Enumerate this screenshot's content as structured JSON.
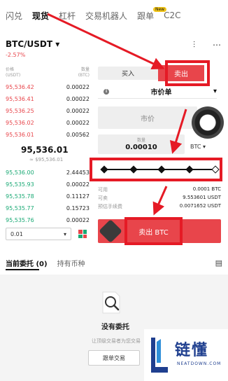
{
  "tabs": [
    {
      "label": "闪兑",
      "active": false
    },
    {
      "label": "现货",
      "active": true
    },
    {
      "label": "杠杆",
      "active": false
    },
    {
      "label": "交易机器人",
      "active": false
    },
    {
      "label": "跟单",
      "active": false,
      "badge": "New"
    },
    {
      "label": "C2C",
      "active": false
    }
  ],
  "pair": {
    "symbol": "BTC/USDT",
    "change": "-2.57%"
  },
  "orderbook": {
    "price_header": "价格\n(USDT)",
    "qty_header": "数量\n(BTC)",
    "asks": [
      {
        "price": "95,536.42",
        "qty": "0.00022"
      },
      {
        "price": "95,536.41",
        "qty": "0.00022"
      },
      {
        "price": "95,536.25",
        "qty": "0.00022"
      },
      {
        "price": "95,536.02",
        "qty": "0.00022"
      },
      {
        "price": "95,536.01",
        "qty": "0.00562"
      }
    ],
    "mid_price": "95,536.01",
    "mid_sub": "≈ $95,536.01",
    "bids": [
      {
        "price": "95,536.00",
        "qty": "2.44453"
      },
      {
        "price": "95,535.93",
        "qty": "0.00022"
      },
      {
        "price": "95,535.78",
        "qty": "0.11127"
      },
      {
        "price": "95,535.77",
        "qty": "0.15723"
      },
      {
        "price": "95,535.76",
        "qty": "0.00022"
      }
    ],
    "decimals": "0.01"
  },
  "trade": {
    "buy_label": "买入",
    "sell_label": "卖出",
    "order_type": "市价单",
    "price_placeholder": "市价",
    "qty_label": "数量",
    "qty_value": "0.00010",
    "qty_unit": "BTC",
    "slider_percent": 100,
    "available_label": "可用",
    "available_value": "0.0001 BTC",
    "sellable_label": "可卖",
    "sellable_value": "9.553601 USDT",
    "fee_label": "预估手续费",
    "fee_value": "0.0071652 USDT",
    "sell_button": "卖出 BTC"
  },
  "orders_section": {
    "tab_open": "当前委托 (0)",
    "tab_holdings": "持有币种",
    "empty_title": "没有委托",
    "empty_desc": "让顶级交易者为您交易",
    "follow_button": "跟单交易"
  },
  "watermark": {
    "title": "链懂",
    "subtitle": "NEATDOWN.COM"
  },
  "colors": {
    "sell": "#e8454b",
    "buy": "#19a974",
    "annotation": "#e51a25",
    "brand": "#1f3f8f"
  }
}
